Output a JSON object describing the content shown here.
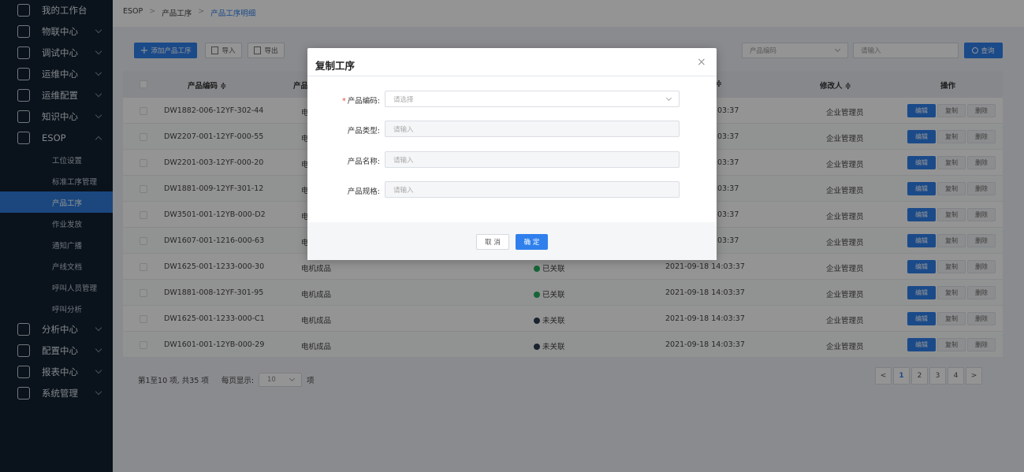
{
  "sidebar": {
    "top_items": [
      {
        "label": "我的工作台",
        "icon": "desktop-icon"
      },
      {
        "label": "物联中心",
        "icon": "iot-icon"
      },
      {
        "label": "调试中心",
        "icon": "debug-icon"
      },
      {
        "label": "运维中心",
        "icon": "home-icon"
      },
      {
        "label": "运维配置",
        "icon": "gear-icon"
      },
      {
        "label": "知识中心",
        "icon": "book-icon"
      },
      {
        "label": "ESOP",
        "icon": "esop-icon"
      }
    ],
    "esop_sub_items": [
      "工位设置",
      "标准工序管理",
      "产品工序",
      "作业发放",
      "通知广播",
      "产线文档",
      "呼叫人员管理",
      "呼叫分析"
    ],
    "bottom_items": [
      {
        "label": "分析中心",
        "icon": "chart-icon"
      },
      {
        "label": "配置中心",
        "icon": "config-icon"
      },
      {
        "label": "报表中心",
        "icon": "report-icon"
      },
      {
        "label": "系统管理",
        "icon": "settings-icon"
      }
    ]
  },
  "breadcrumb": {
    "root": "ESOP",
    "level1": "产品工序",
    "current": "产品工序明细"
  },
  "toolbar": {
    "add_label": "添加产品工序",
    "import_label": "导入",
    "export_label": "导出",
    "filter_select": "产品编码",
    "search_placeholder": "请输入",
    "search_label": "查询"
  },
  "table": {
    "headers": {
      "code": "产品编码 ≑",
      "type": "产品",
      "time": "≑",
      "modifier": "修改人 ≑",
      "ops": "操作"
    },
    "rows": [
      {
        "code": "DW1882-006-12YF-302-44",
        "type": "电",
        "status": "",
        "time": "03:37",
        "modifier": "企业管理员"
      },
      {
        "code": "DW2207-001-12YF-000-55",
        "type": "电",
        "status": "",
        "time": "03:37",
        "modifier": "企业管理员"
      },
      {
        "code": "DW2201-003-12YF-000-20",
        "type": "电",
        "status": "",
        "time": "03:37",
        "modifier": "企业管理员"
      },
      {
        "code": "DW1881-009-12YF-301-12",
        "type": "电",
        "status": "",
        "time": "03:37",
        "modifier": "企业管理员"
      },
      {
        "code": "DW3501-001-12YB-000-D2",
        "type": "电",
        "status": "",
        "time": "03:37",
        "modifier": "企业管理员"
      },
      {
        "code": "DW1607-001-1216-000-63",
        "type": "电",
        "status": "",
        "time": "03:37",
        "modifier": "企业管理员"
      },
      {
        "code": "DW1625-001-1233-000-30",
        "type": "电机成品",
        "status": "已关联",
        "time": "2021-09-18 14:03:37",
        "modifier": "企业管理员"
      },
      {
        "code": "DW1881-008-12YF-301-95",
        "type": "电机成品",
        "status": "已关联",
        "time": "2021-09-18 14:03:37",
        "modifier": "企业管理员"
      },
      {
        "code": "DW1625-001-1233-000-C1",
        "type": "电机成品",
        "status": "未关联",
        "time": "2021-09-18 14:03:37",
        "modifier": "企业管理员"
      },
      {
        "code": "DW1601-001-12YB-000-29",
        "type": "电机成品",
        "status": "未关联",
        "time": "2021-09-18 14:03:37",
        "modifier": "企业管理员"
      }
    ],
    "op_labels": {
      "edit": "编辑",
      "copy": "复制",
      "delete": "删除"
    }
  },
  "pagination": {
    "summary": "第1至10 项, 共35 项",
    "page_size_label": "每页显示:",
    "page_size": "10",
    "unit": "项",
    "pages": [
      "1",
      "2",
      "3",
      "4"
    ],
    "prev": "<",
    "next": ">"
  },
  "modal": {
    "title": "复制工序",
    "close": "×",
    "fields": [
      {
        "label": "产品编码:",
        "required": true,
        "placeholder": "请选择",
        "kind": "select"
      },
      {
        "label": "产品类型:",
        "required": false,
        "placeholder": "请输入",
        "kind": "input"
      },
      {
        "label": "产品名称:",
        "required": false,
        "placeholder": "请输入",
        "kind": "input"
      },
      {
        "label": "产品规格:",
        "required": false,
        "placeholder": "请输入",
        "kind": "input"
      }
    ],
    "cancel_label": "取 消",
    "ok_label": "确 定"
  },
  "colors": {
    "accent": "#2f80ed",
    "sidebar_bg": "#12202f",
    "linked": "#27ae60",
    "unlinked": "#2c3e50"
  }
}
